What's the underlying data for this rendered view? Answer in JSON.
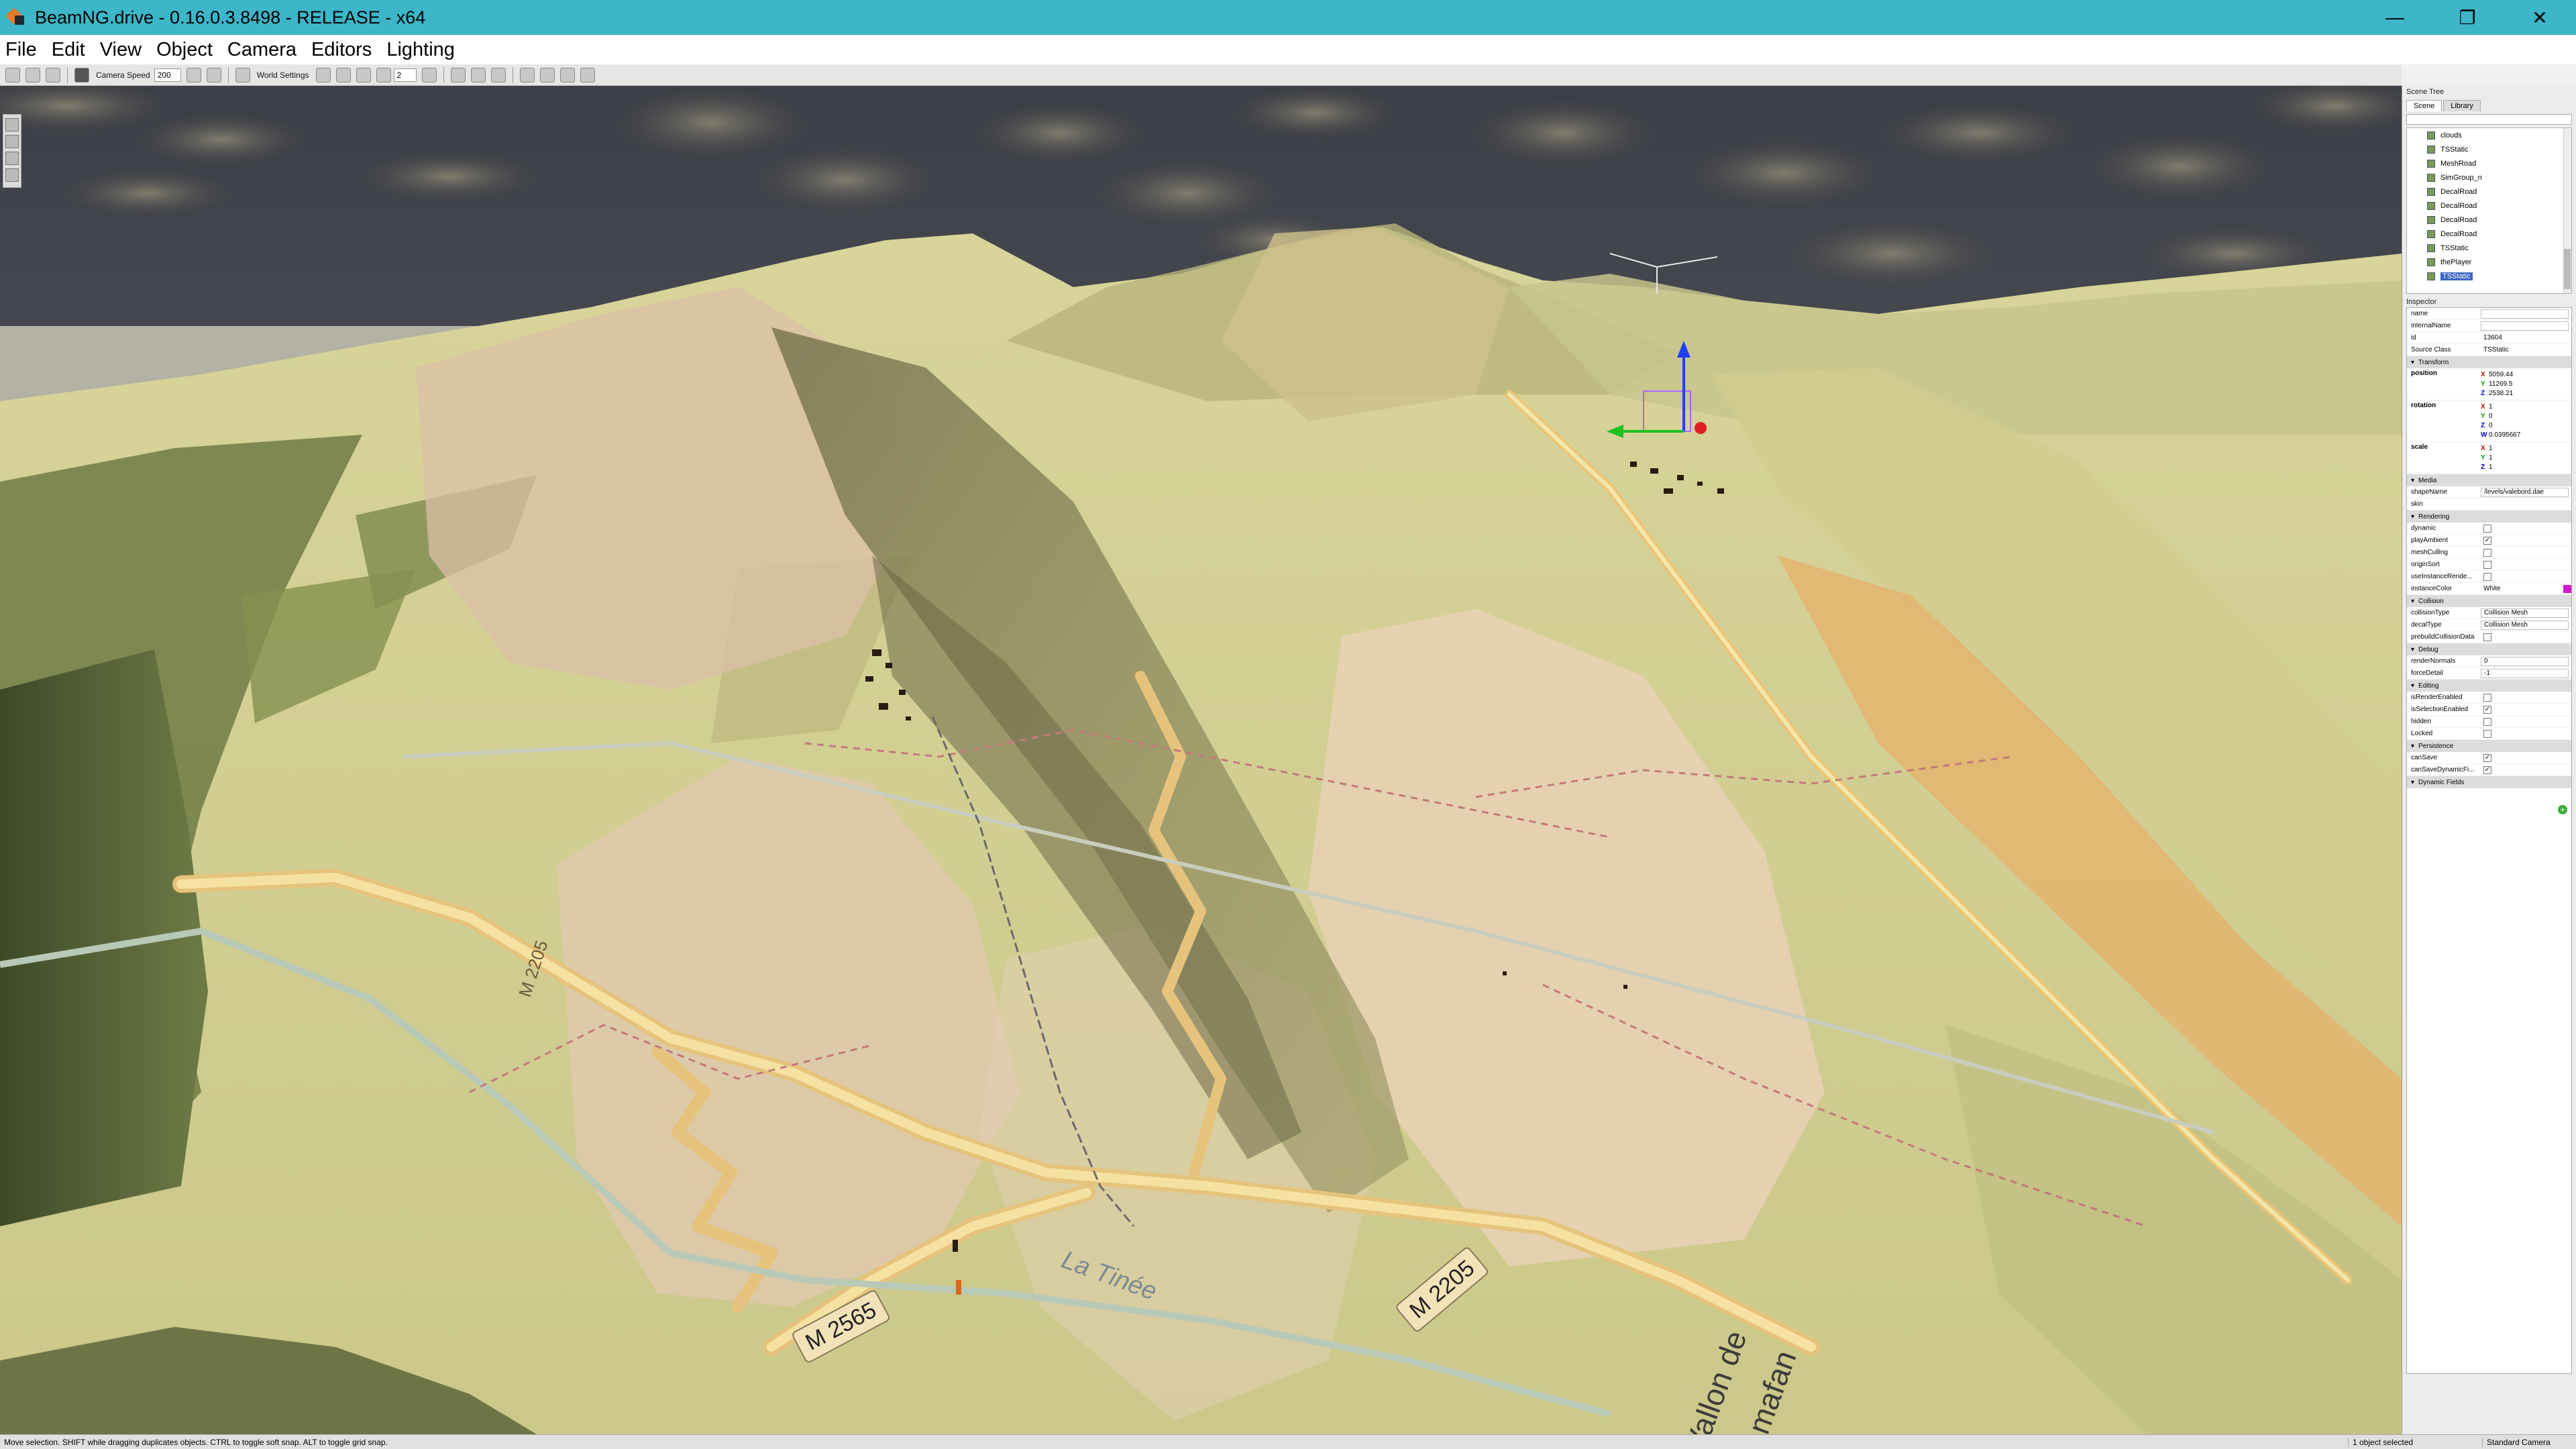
{
  "window": {
    "title": "BeamNG.drive - 0.16.0.3.8498 - RELEASE - x64",
    "minimize": "—",
    "maximize": "❐",
    "close": "✕"
  },
  "menu": [
    "File",
    "Edit",
    "View",
    "Object",
    "Camera",
    "Editors",
    "Lighting"
  ],
  "toolbar": {
    "camera_speed_label": "Camera Speed",
    "camera_speed_value": "200",
    "world_settings_label": "World Settings",
    "grid_value": "2"
  },
  "map_labels": {
    "road1": "M 2565",
    "road2": "M 2205",
    "road3": "M 2205",
    "river": "La Tinée",
    "valley_line1": "Vallon de",
    "valley_line2": "Bramafan"
  },
  "scene_tree": {
    "title": "Scene Tree",
    "tabs": [
      "Scene",
      "Library"
    ],
    "items": [
      "clouds",
      "TSStatic",
      "MeshRoad",
      "SimGroup_n",
      "DecalRoad",
      "DecalRoad",
      "DecalRoad",
      "DecalRoad",
      "TSStatic",
      "thePlayer",
      "TSStatic"
    ]
  },
  "inspector": {
    "title": "Inspector",
    "name_label": "name",
    "internal_name_label": "internalName",
    "id_label": "id",
    "id_value": "13604",
    "source_class_label": "Source Class",
    "source_class_value": "TSStatic",
    "sections": {
      "transform": "Transform",
      "media": "Media",
      "rendering": "Rendering",
      "collision": "Collision",
      "debug": "Debug",
      "editing": "Editing",
      "persistence": "Persistence",
      "dynamic_fields": "Dynamic Fields"
    },
    "position_label": "position",
    "position": [
      "5059.44",
      "11269.5",
      "2538.21"
    ],
    "rotation_label": "rotation",
    "rotation": [
      "1",
      "0",
      "0",
      "0.0395667"
    ],
    "scale_label": "scale",
    "scale": [
      "1",
      "1",
      "1"
    ],
    "shape_name_label": "shapeName",
    "shape_name_value": "/levels/valebord.dae",
    "skin_label": "skin",
    "rendering_fields": [
      "dynamic",
      "playAmbient",
      "meshCulling",
      "originSort",
      "useInstanceRende...",
      "instanceColor"
    ],
    "instance_color_value": "White",
    "collision_type_label": "collisionType",
    "collision_type_value": "Collision Mesh",
    "decal_type_label": "decalType",
    "decal_type_value": "Collision Mesh",
    "prebuild_label": "prebuildCollisionData",
    "render_normals_label": "renderNormals",
    "render_normals_value": "0",
    "force_detail_label": "forceDetail",
    "force_detail_value": "-1",
    "editing_fields": [
      "isRenderEnabled",
      "isSelectionEnabled",
      "hidden",
      "Locked"
    ],
    "persistence_fields": [
      "canSave",
      "canSaveDynamicFi..."
    ]
  },
  "statusbar": {
    "message": "Move selection.  SHIFT while dragging duplicates objects.  CTRL to toggle soft snap.  ALT to toggle grid snap.",
    "selection": "1 object selected",
    "camera": "Standard Camera"
  }
}
